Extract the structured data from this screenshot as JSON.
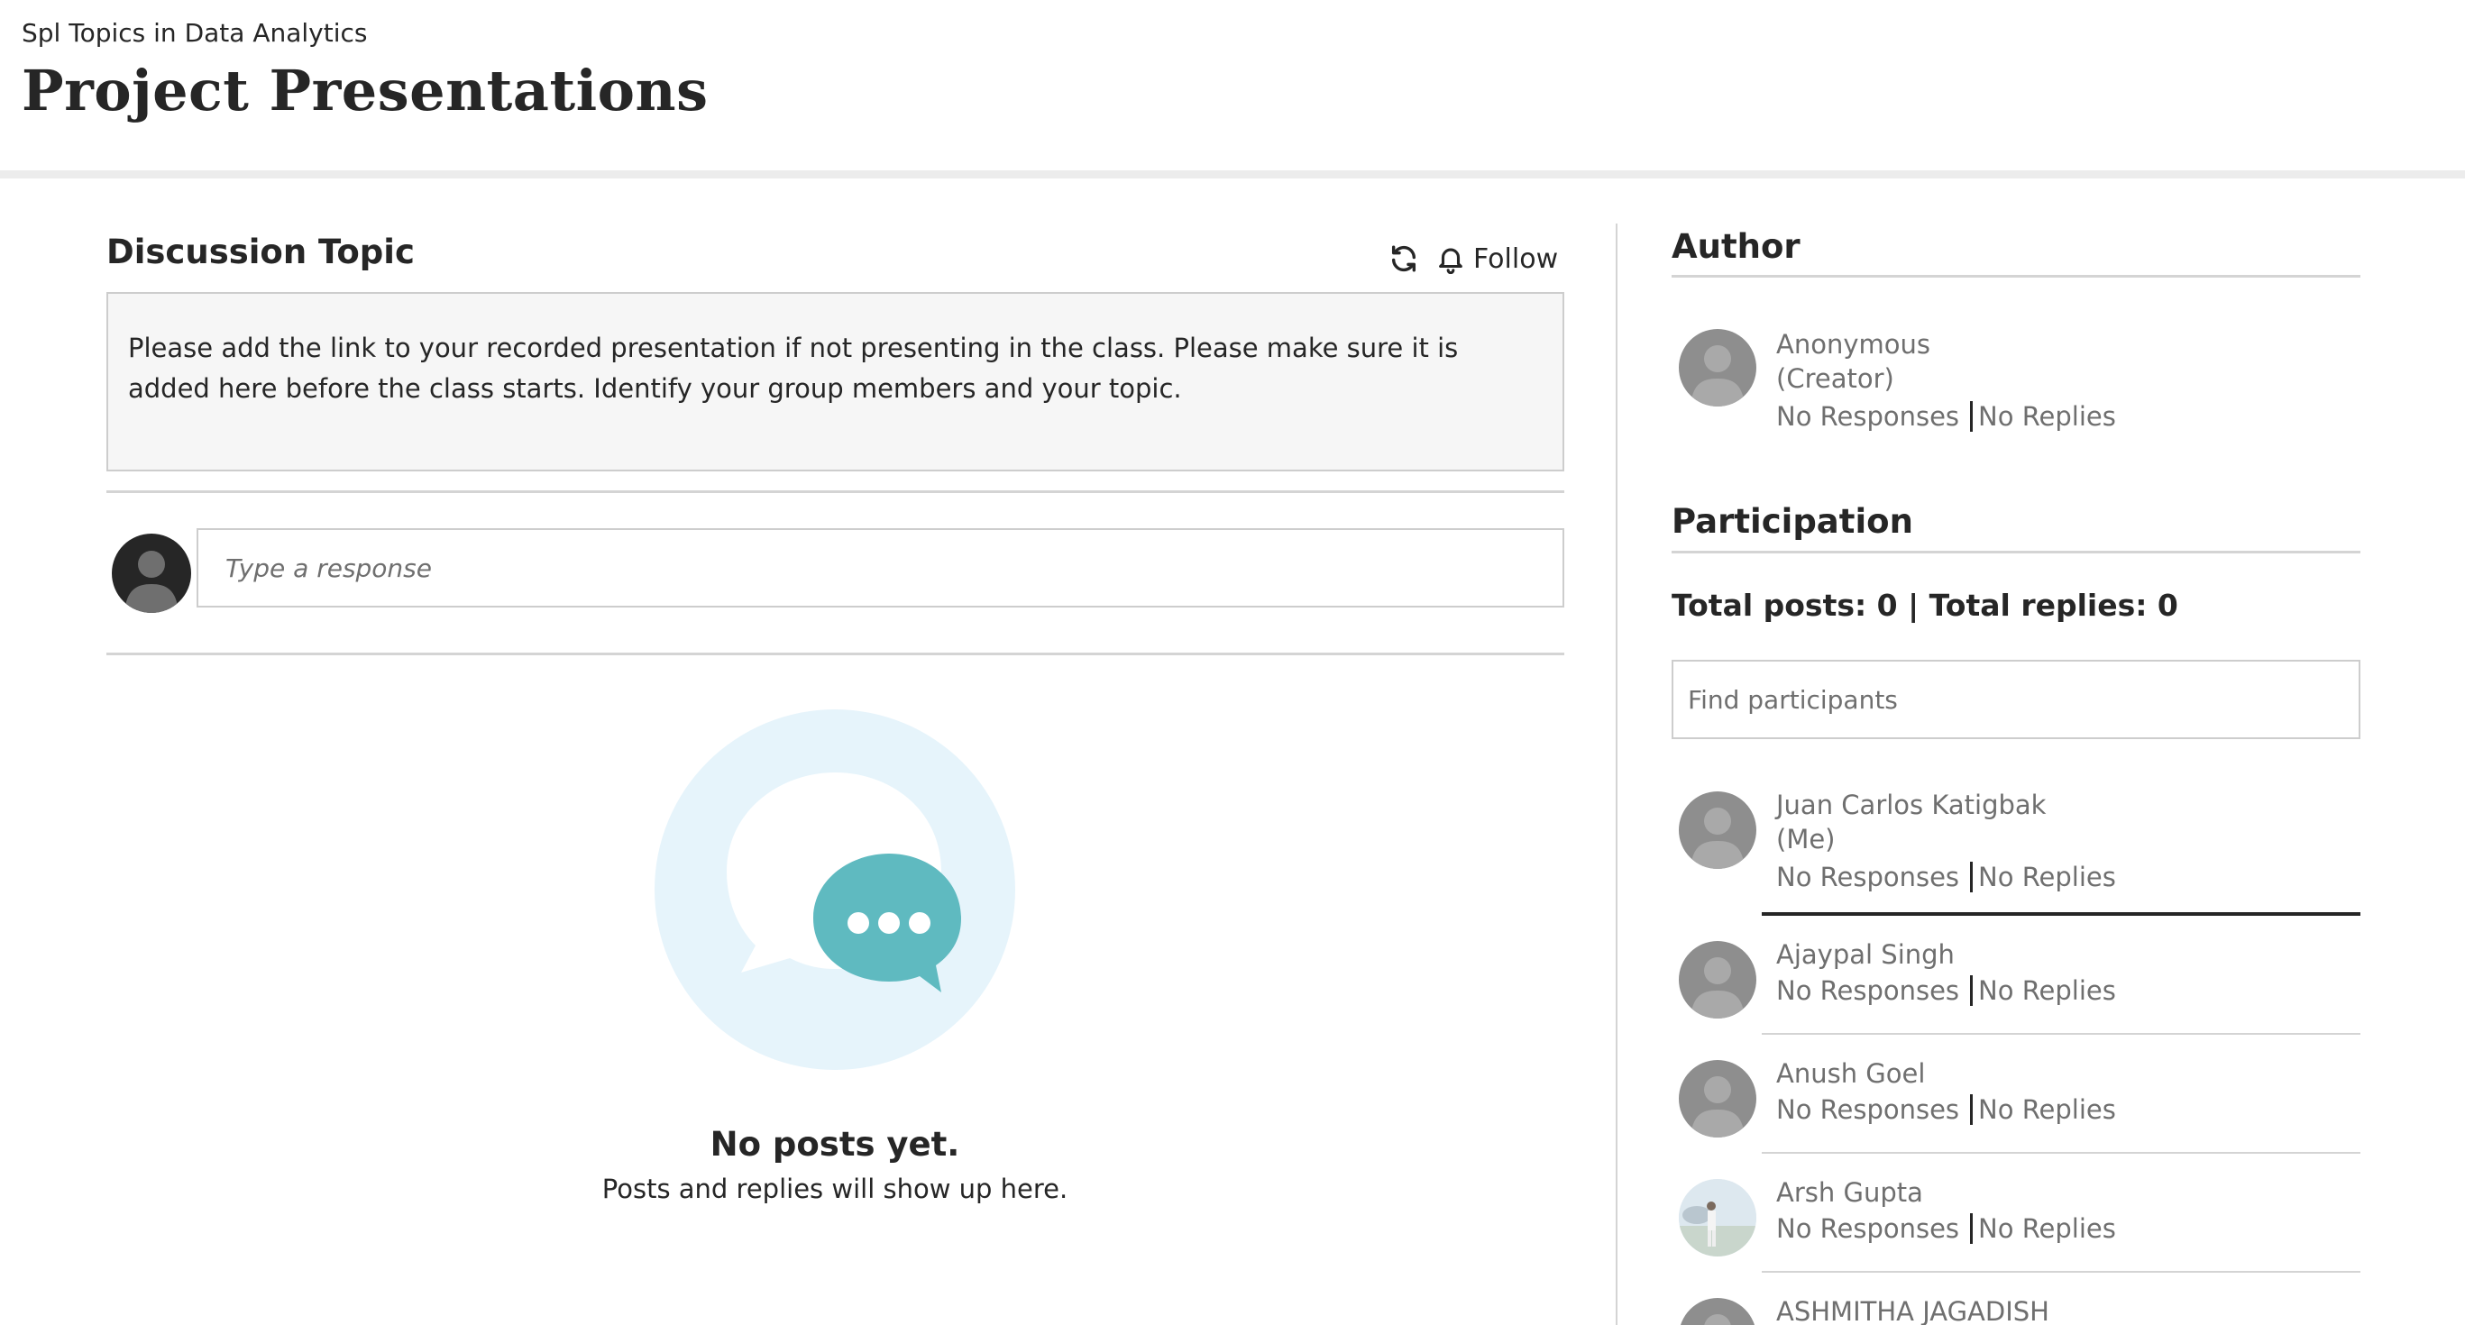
{
  "header": {
    "breadcrumb": "Spl Topics in Data Analytics",
    "title": "Project Presentations"
  },
  "topic": {
    "section_title": "Discussion Topic",
    "follow_label": "Follow",
    "body": "Please add the link to your recorded presentation if not presenting in the class. Please make sure it is added here before the class starts. Identify your group members and your topic."
  },
  "response": {
    "placeholder": "Type a response"
  },
  "empty_state": {
    "title": "No posts yet.",
    "subtitle": "Posts and replies will show up here."
  },
  "author": {
    "section_title": "Author",
    "name": "Anonymous",
    "role": "(Creator)",
    "responses": "No Responses",
    "replies": "No Replies"
  },
  "participation": {
    "section_title": "Participation",
    "totals": "Total posts: 0 | Total replies: 0",
    "search_placeholder": "Find participants",
    "participants": [
      {
        "name": "Juan Carlos Katigbak",
        "tag": "(Me)",
        "responses": "No Responses",
        "replies": "No Replies"
      },
      {
        "name": "Ajaypal Singh",
        "responses": "No Responses",
        "replies": "No Replies"
      },
      {
        "name": "Anush Goel",
        "responses": "No Responses",
        "replies": "No Replies"
      },
      {
        "name": "Arsh Gupta",
        "responses": "No Responses",
        "replies": "No Replies"
      },
      {
        "name": "ASHMITHA JAGADISH"
      }
    ]
  },
  "colors": {
    "text": "#262626",
    "muted": "#6f6f6f",
    "teal": "#5fbac0",
    "light_blue": "#e6f4fb",
    "avatar_gray": "#8e8e8e"
  }
}
